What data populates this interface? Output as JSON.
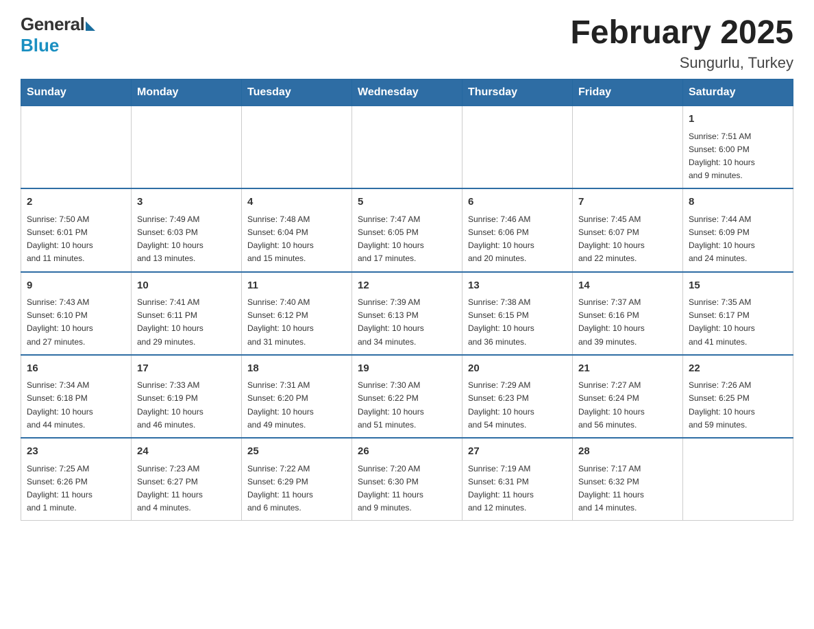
{
  "logo": {
    "general": "General",
    "blue": "Blue"
  },
  "title": "February 2025",
  "subtitle": "Sungurlu, Turkey",
  "days": [
    "Sunday",
    "Monday",
    "Tuesday",
    "Wednesday",
    "Thursday",
    "Friday",
    "Saturday"
  ],
  "weeks": [
    [
      {
        "day": "",
        "info": ""
      },
      {
        "day": "",
        "info": ""
      },
      {
        "day": "",
        "info": ""
      },
      {
        "day": "",
        "info": ""
      },
      {
        "day": "",
        "info": ""
      },
      {
        "day": "",
        "info": ""
      },
      {
        "day": "1",
        "info": "Sunrise: 7:51 AM\nSunset: 6:00 PM\nDaylight: 10 hours\nand 9 minutes."
      }
    ],
    [
      {
        "day": "2",
        "info": "Sunrise: 7:50 AM\nSunset: 6:01 PM\nDaylight: 10 hours\nand 11 minutes."
      },
      {
        "day": "3",
        "info": "Sunrise: 7:49 AM\nSunset: 6:03 PM\nDaylight: 10 hours\nand 13 minutes."
      },
      {
        "day": "4",
        "info": "Sunrise: 7:48 AM\nSunset: 6:04 PM\nDaylight: 10 hours\nand 15 minutes."
      },
      {
        "day": "5",
        "info": "Sunrise: 7:47 AM\nSunset: 6:05 PM\nDaylight: 10 hours\nand 17 minutes."
      },
      {
        "day": "6",
        "info": "Sunrise: 7:46 AM\nSunset: 6:06 PM\nDaylight: 10 hours\nand 20 minutes."
      },
      {
        "day": "7",
        "info": "Sunrise: 7:45 AM\nSunset: 6:07 PM\nDaylight: 10 hours\nand 22 minutes."
      },
      {
        "day": "8",
        "info": "Sunrise: 7:44 AM\nSunset: 6:09 PM\nDaylight: 10 hours\nand 24 minutes."
      }
    ],
    [
      {
        "day": "9",
        "info": "Sunrise: 7:43 AM\nSunset: 6:10 PM\nDaylight: 10 hours\nand 27 minutes."
      },
      {
        "day": "10",
        "info": "Sunrise: 7:41 AM\nSunset: 6:11 PM\nDaylight: 10 hours\nand 29 minutes."
      },
      {
        "day": "11",
        "info": "Sunrise: 7:40 AM\nSunset: 6:12 PM\nDaylight: 10 hours\nand 31 minutes."
      },
      {
        "day": "12",
        "info": "Sunrise: 7:39 AM\nSunset: 6:13 PM\nDaylight: 10 hours\nand 34 minutes."
      },
      {
        "day": "13",
        "info": "Sunrise: 7:38 AM\nSunset: 6:15 PM\nDaylight: 10 hours\nand 36 minutes."
      },
      {
        "day": "14",
        "info": "Sunrise: 7:37 AM\nSunset: 6:16 PM\nDaylight: 10 hours\nand 39 minutes."
      },
      {
        "day": "15",
        "info": "Sunrise: 7:35 AM\nSunset: 6:17 PM\nDaylight: 10 hours\nand 41 minutes."
      }
    ],
    [
      {
        "day": "16",
        "info": "Sunrise: 7:34 AM\nSunset: 6:18 PM\nDaylight: 10 hours\nand 44 minutes."
      },
      {
        "day": "17",
        "info": "Sunrise: 7:33 AM\nSunset: 6:19 PM\nDaylight: 10 hours\nand 46 minutes."
      },
      {
        "day": "18",
        "info": "Sunrise: 7:31 AM\nSunset: 6:20 PM\nDaylight: 10 hours\nand 49 minutes."
      },
      {
        "day": "19",
        "info": "Sunrise: 7:30 AM\nSunset: 6:22 PM\nDaylight: 10 hours\nand 51 minutes."
      },
      {
        "day": "20",
        "info": "Sunrise: 7:29 AM\nSunset: 6:23 PM\nDaylight: 10 hours\nand 54 minutes."
      },
      {
        "day": "21",
        "info": "Sunrise: 7:27 AM\nSunset: 6:24 PM\nDaylight: 10 hours\nand 56 minutes."
      },
      {
        "day": "22",
        "info": "Sunrise: 7:26 AM\nSunset: 6:25 PM\nDaylight: 10 hours\nand 59 minutes."
      }
    ],
    [
      {
        "day": "23",
        "info": "Sunrise: 7:25 AM\nSunset: 6:26 PM\nDaylight: 11 hours\nand 1 minute."
      },
      {
        "day": "24",
        "info": "Sunrise: 7:23 AM\nSunset: 6:27 PM\nDaylight: 11 hours\nand 4 minutes."
      },
      {
        "day": "25",
        "info": "Sunrise: 7:22 AM\nSunset: 6:29 PM\nDaylight: 11 hours\nand 6 minutes."
      },
      {
        "day": "26",
        "info": "Sunrise: 7:20 AM\nSunset: 6:30 PM\nDaylight: 11 hours\nand 9 minutes."
      },
      {
        "day": "27",
        "info": "Sunrise: 7:19 AM\nSunset: 6:31 PM\nDaylight: 11 hours\nand 12 minutes."
      },
      {
        "day": "28",
        "info": "Sunrise: 7:17 AM\nSunset: 6:32 PM\nDaylight: 11 hours\nand 14 minutes."
      },
      {
        "day": "",
        "info": ""
      }
    ]
  ]
}
